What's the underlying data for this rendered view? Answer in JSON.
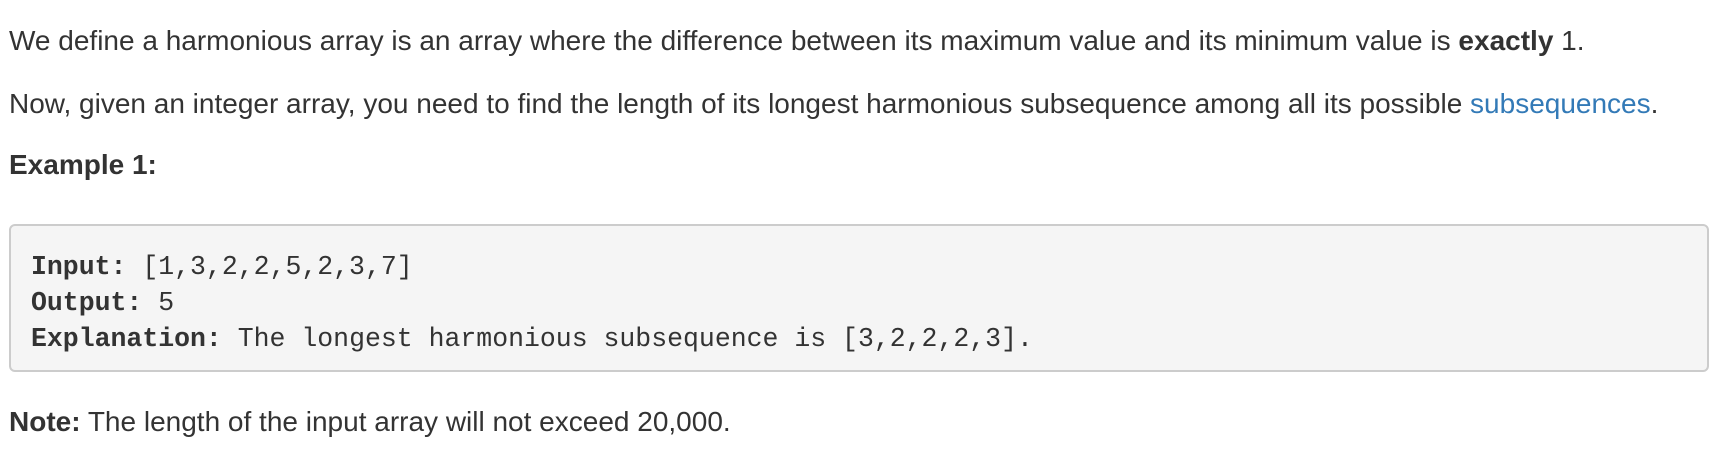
{
  "intro": {
    "text_before_bold": "We define a harmonious array is an array where the difference between its maximum value and its minimum value is ",
    "bold": "exactly",
    "text_after_bold": " 1."
  },
  "task": {
    "text_before_link": "Now, given an integer array, you need to find the length of its longest harmonious subsequence among all its possible ",
    "link_text": "subsequences",
    "text_after_link": "."
  },
  "example": {
    "heading": "Example 1:",
    "input_label": "Input:",
    "input_value": " [1,3,2,2,5,2,3,7]",
    "output_label": "Output:",
    "output_value": " 5",
    "explanation_label": "Explanation:",
    "explanation_value": " The longest harmonious subsequence is [3,2,2,2,3]."
  },
  "note": {
    "label": "Note:",
    "text": " The length of the input array will not exceed 20,000."
  }
}
